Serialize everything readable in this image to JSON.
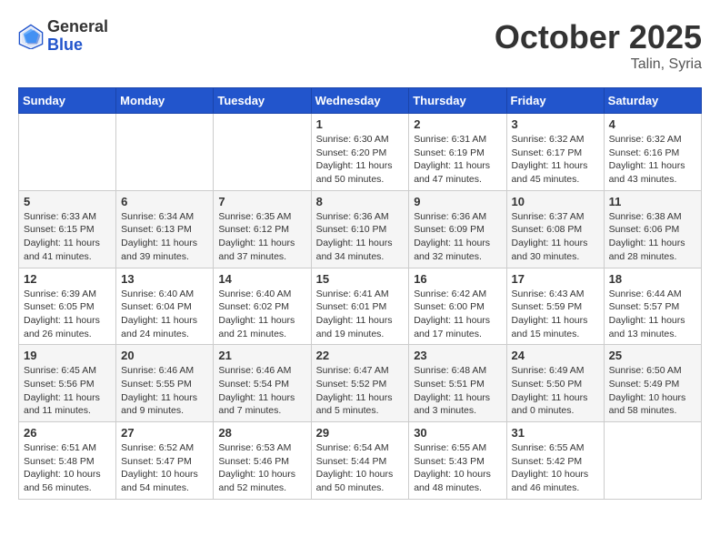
{
  "logo": {
    "general": "General",
    "blue": "Blue"
  },
  "title": "October 2025",
  "location": "Talin, Syria",
  "weekdays": [
    "Sunday",
    "Monday",
    "Tuesday",
    "Wednesday",
    "Thursday",
    "Friday",
    "Saturday"
  ],
  "weeks": [
    [
      {
        "day": "",
        "info": ""
      },
      {
        "day": "",
        "info": ""
      },
      {
        "day": "",
        "info": ""
      },
      {
        "day": "1",
        "info": "Sunrise: 6:30 AM\nSunset: 6:20 PM\nDaylight: 11 hours and 50 minutes."
      },
      {
        "day": "2",
        "info": "Sunrise: 6:31 AM\nSunset: 6:19 PM\nDaylight: 11 hours and 47 minutes."
      },
      {
        "day": "3",
        "info": "Sunrise: 6:32 AM\nSunset: 6:17 PM\nDaylight: 11 hours and 45 minutes."
      },
      {
        "day": "4",
        "info": "Sunrise: 6:32 AM\nSunset: 6:16 PM\nDaylight: 11 hours and 43 minutes."
      }
    ],
    [
      {
        "day": "5",
        "info": "Sunrise: 6:33 AM\nSunset: 6:15 PM\nDaylight: 11 hours and 41 minutes."
      },
      {
        "day": "6",
        "info": "Sunrise: 6:34 AM\nSunset: 6:13 PM\nDaylight: 11 hours and 39 minutes."
      },
      {
        "day": "7",
        "info": "Sunrise: 6:35 AM\nSunset: 6:12 PM\nDaylight: 11 hours and 37 minutes."
      },
      {
        "day": "8",
        "info": "Sunrise: 6:36 AM\nSunset: 6:10 PM\nDaylight: 11 hours and 34 minutes."
      },
      {
        "day": "9",
        "info": "Sunrise: 6:36 AM\nSunset: 6:09 PM\nDaylight: 11 hours and 32 minutes."
      },
      {
        "day": "10",
        "info": "Sunrise: 6:37 AM\nSunset: 6:08 PM\nDaylight: 11 hours and 30 minutes."
      },
      {
        "day": "11",
        "info": "Sunrise: 6:38 AM\nSunset: 6:06 PM\nDaylight: 11 hours and 28 minutes."
      }
    ],
    [
      {
        "day": "12",
        "info": "Sunrise: 6:39 AM\nSunset: 6:05 PM\nDaylight: 11 hours and 26 minutes."
      },
      {
        "day": "13",
        "info": "Sunrise: 6:40 AM\nSunset: 6:04 PM\nDaylight: 11 hours and 24 minutes."
      },
      {
        "day": "14",
        "info": "Sunrise: 6:40 AM\nSunset: 6:02 PM\nDaylight: 11 hours and 21 minutes."
      },
      {
        "day": "15",
        "info": "Sunrise: 6:41 AM\nSunset: 6:01 PM\nDaylight: 11 hours and 19 minutes."
      },
      {
        "day": "16",
        "info": "Sunrise: 6:42 AM\nSunset: 6:00 PM\nDaylight: 11 hours and 17 minutes."
      },
      {
        "day": "17",
        "info": "Sunrise: 6:43 AM\nSunset: 5:59 PM\nDaylight: 11 hours and 15 minutes."
      },
      {
        "day": "18",
        "info": "Sunrise: 6:44 AM\nSunset: 5:57 PM\nDaylight: 11 hours and 13 minutes."
      }
    ],
    [
      {
        "day": "19",
        "info": "Sunrise: 6:45 AM\nSunset: 5:56 PM\nDaylight: 11 hours and 11 minutes."
      },
      {
        "day": "20",
        "info": "Sunrise: 6:46 AM\nSunset: 5:55 PM\nDaylight: 11 hours and 9 minutes."
      },
      {
        "day": "21",
        "info": "Sunrise: 6:46 AM\nSunset: 5:54 PM\nDaylight: 11 hours and 7 minutes."
      },
      {
        "day": "22",
        "info": "Sunrise: 6:47 AM\nSunset: 5:52 PM\nDaylight: 11 hours and 5 minutes."
      },
      {
        "day": "23",
        "info": "Sunrise: 6:48 AM\nSunset: 5:51 PM\nDaylight: 11 hours and 3 minutes."
      },
      {
        "day": "24",
        "info": "Sunrise: 6:49 AM\nSunset: 5:50 PM\nDaylight: 11 hours and 0 minutes."
      },
      {
        "day": "25",
        "info": "Sunrise: 6:50 AM\nSunset: 5:49 PM\nDaylight: 10 hours and 58 minutes."
      }
    ],
    [
      {
        "day": "26",
        "info": "Sunrise: 6:51 AM\nSunset: 5:48 PM\nDaylight: 10 hours and 56 minutes."
      },
      {
        "day": "27",
        "info": "Sunrise: 6:52 AM\nSunset: 5:47 PM\nDaylight: 10 hours and 54 minutes."
      },
      {
        "day": "28",
        "info": "Sunrise: 6:53 AM\nSunset: 5:46 PM\nDaylight: 10 hours and 52 minutes."
      },
      {
        "day": "29",
        "info": "Sunrise: 6:54 AM\nSunset: 5:44 PM\nDaylight: 10 hours and 50 minutes."
      },
      {
        "day": "30",
        "info": "Sunrise: 6:55 AM\nSunset: 5:43 PM\nDaylight: 10 hours and 48 minutes."
      },
      {
        "day": "31",
        "info": "Sunrise: 6:55 AM\nSunset: 5:42 PM\nDaylight: 10 hours and 46 minutes."
      },
      {
        "day": "",
        "info": ""
      }
    ]
  ]
}
